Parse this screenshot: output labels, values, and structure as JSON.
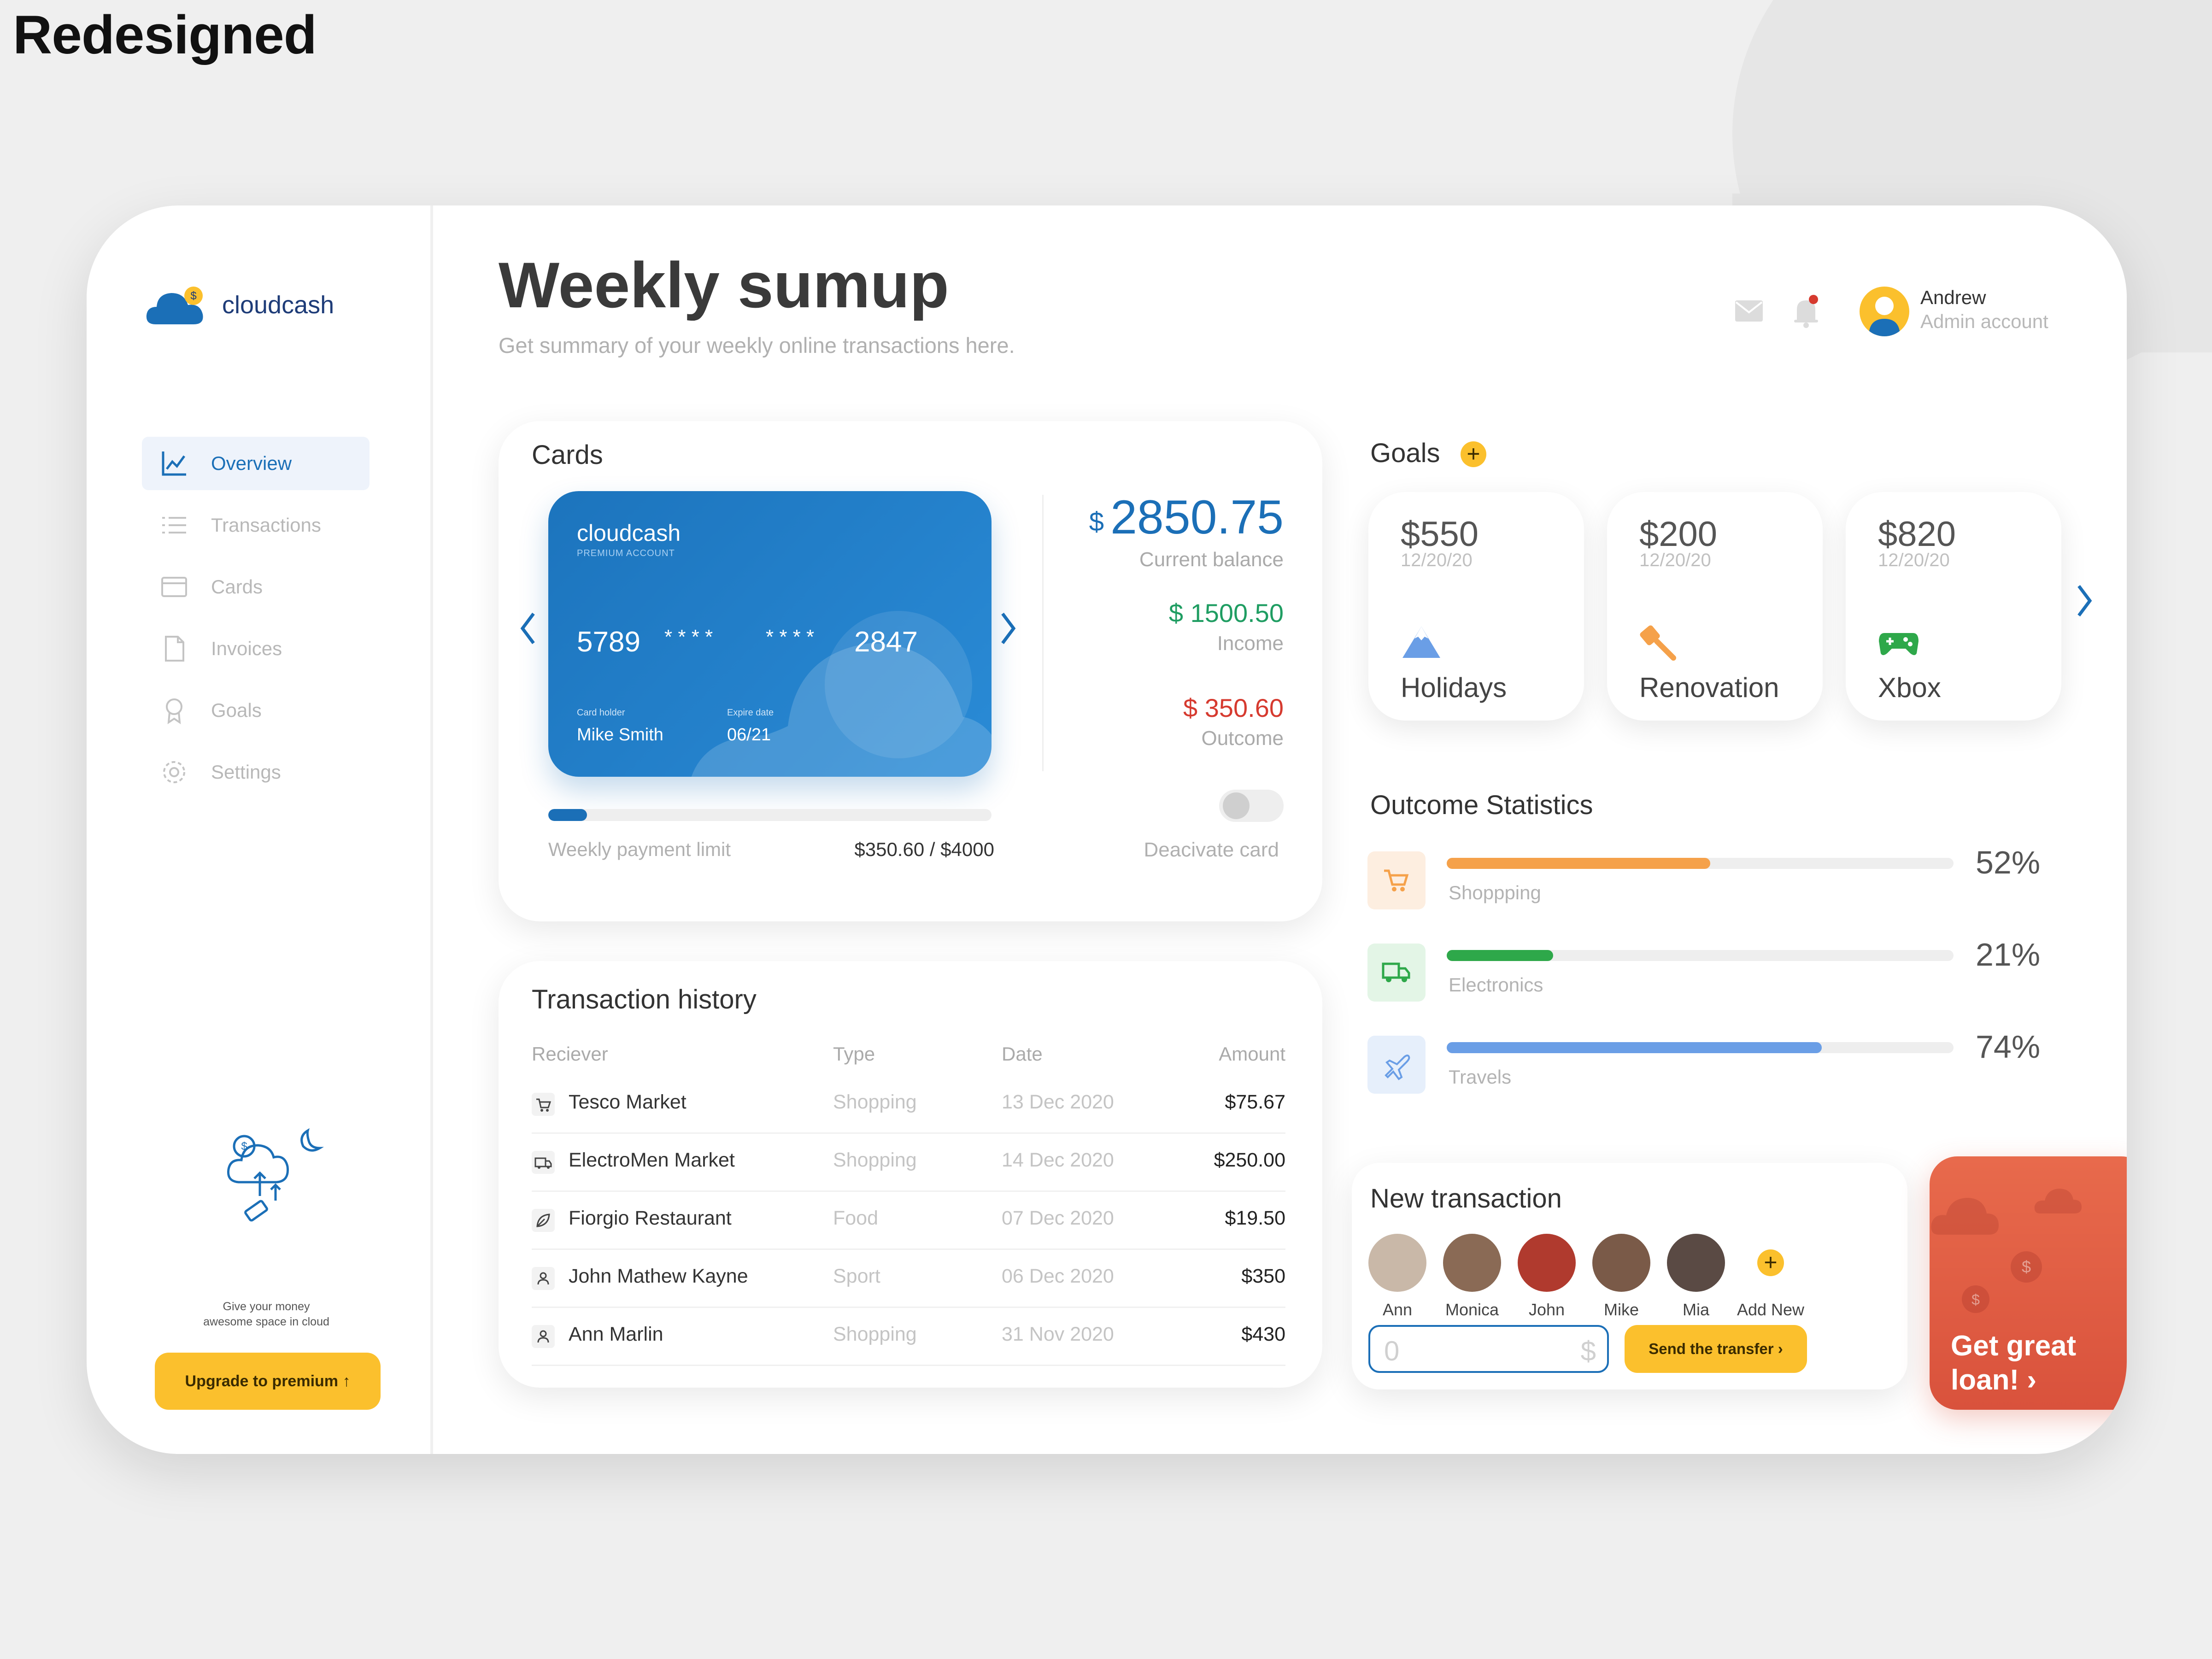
{
  "page_label": "Redesigned",
  "brand": {
    "name": "cloudcash"
  },
  "nav": {
    "items": [
      {
        "label": "Overview",
        "icon": "chart-line-icon"
      },
      {
        "label": "Transactions",
        "icon": "list-icon"
      },
      {
        "label": "Cards",
        "icon": "credit-card-icon"
      },
      {
        "label": "Invoices",
        "icon": "document-icon"
      },
      {
        "label": "Goals",
        "icon": "award-icon"
      },
      {
        "label": "Settings",
        "icon": "gear-icon"
      }
    ],
    "active": "Overview"
  },
  "promo": {
    "line1": "Give your money",
    "line2": "awesome space in cloud",
    "button": "Upgrade to premium ↑"
  },
  "header": {
    "title": "Weekly sumup",
    "subtitle": "Get summary of your weekly online transactions here."
  },
  "user": {
    "name": "Andrew",
    "role": "Admin account"
  },
  "cards": {
    "title": "Cards",
    "card": {
      "brand": "cloudcash",
      "tier": "PREMIUM ACCOUNT",
      "num1": "5789",
      "num2": "* * * *",
      "num3": "* * * *",
      "num4": "2847",
      "holder_label": "Card holder",
      "holder": "Mike Smith",
      "expiry_label": "Expire date",
      "expiry": "06/21"
    },
    "balance_currency": "$",
    "balance": "2850.75",
    "balance_label": "Current balance",
    "income": "$ 1500.50",
    "income_label": "Income",
    "outcome": "$ 350.60",
    "outcome_label": "Outcome",
    "limit_label": "Weekly payment limit",
    "limit_value": "$350.60 / $4000",
    "limit_fraction": 0.0877,
    "deactivate_label": "Deacivate card"
  },
  "goals": {
    "title": "Goals",
    "items": [
      {
        "amount": "$550",
        "date": "12/20/20",
        "name": "Holidays",
        "icon": "mountain-icon"
      },
      {
        "amount": "$200",
        "date": "12/20/20",
        "name": "Renovation",
        "icon": "brush-icon"
      },
      {
        "amount": "$820",
        "date": "12/20/20",
        "name": "Xbox",
        "icon": "gamepad-icon"
      }
    ]
  },
  "stats": {
    "title": "Outcome Statistics",
    "items": [
      {
        "label": "Shoppping",
        "pct": "52%",
        "value": 52,
        "color": "#f5a14a",
        "bg": "#fdeee0",
        "icon": "cart-icon"
      },
      {
        "label": "Electronics",
        "pct": "21%",
        "value": 21,
        "color": "#2ea84a",
        "bg": "#e3f5e6",
        "icon": "truck-icon"
      },
      {
        "label": "Travels",
        "pct": "74%",
        "value": 74,
        "color": "#6a9ee6",
        "bg": "#e6effb",
        "icon": "plane-icon"
      }
    ]
  },
  "history": {
    "title": "Transaction history",
    "columns": [
      "Reciever",
      "Type",
      "Date",
      "Amount"
    ],
    "rows": [
      {
        "receiver": "Tesco Market",
        "type": "Shopping",
        "date": "13 Dec 2020",
        "amount": "$75.67",
        "icon": "cart-icon"
      },
      {
        "receiver": "ElectroMen Market",
        "type": "Shopping",
        "date": "14 Dec 2020",
        "amount": "$250.00",
        "icon": "truck-icon"
      },
      {
        "receiver": "Fiorgio Restaurant",
        "type": "Food",
        "date": "07 Dec 2020",
        "amount": "$19.50",
        "icon": "leaf-icon"
      },
      {
        "receiver": "John Mathew Kayne",
        "type": "Sport",
        "date": "06 Dec 2020",
        "amount": "$350",
        "icon": "user-icon"
      },
      {
        "receiver": "Ann Marlin",
        "type": "Shopping",
        "date": "31 Nov 2020",
        "amount": "$430",
        "icon": "user-icon"
      }
    ]
  },
  "new_transaction": {
    "title": "New transaction",
    "contacts": [
      {
        "name": "Ann",
        "color": "#c9b8a8"
      },
      {
        "name": "Monica",
        "color": "#8a6a55"
      },
      {
        "name": "John",
        "color": "#b03a2e"
      },
      {
        "name": "Mike",
        "color": "#7a5a48"
      },
      {
        "name": "Mia",
        "color": "#5a4a44"
      }
    ],
    "add_new": "Add New",
    "amount_placeholder": "0",
    "currency": "$",
    "send_button": "Send the transfer ›"
  },
  "loan": {
    "line1": "Get great",
    "line2": "loan! ›"
  },
  "colors": {
    "accent": "#1b6fb7",
    "yellow": "#fbc02d",
    "income": "#1f9d62",
    "outcome": "#d63a2f",
    "loan": "#e05a3f"
  }
}
